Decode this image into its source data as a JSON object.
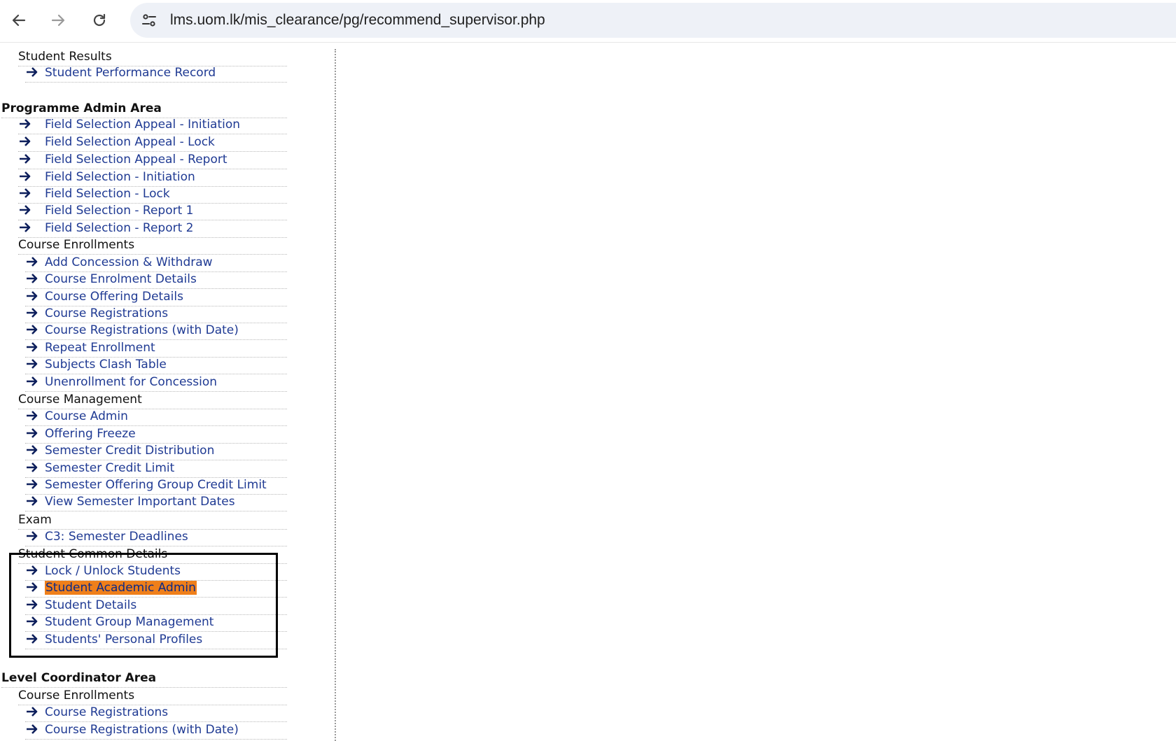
{
  "browser": {
    "url": "lms.uom.lk/mis_clearance/pg/recommend_supervisor.php",
    "icons": {
      "back": "arrow-left-icon",
      "forward": "arrow-right-icon",
      "reload": "reload-icon",
      "site_info": "tune-icon"
    }
  },
  "menu": {
    "student_results": {
      "label": "Student Results",
      "items": [
        "Student Performance Record"
      ]
    },
    "programme_admin": {
      "label": "Programme Admin Area",
      "items": [
        "Field Selection Appeal - Initiation",
        "Field Selection Appeal - Lock",
        "Field Selection Appeal - Report",
        "Field Selection - Initiation",
        "Field Selection - Lock",
        "Field Selection - Report 1",
        "Field Selection - Report 2"
      ],
      "course_enrollments": {
        "label": "Course Enrollments",
        "items": [
          "Add Concession & Withdraw",
          "Course Enrolment Details",
          "Course Offering Details",
          "Course Registrations",
          "Course Registrations (with Date)",
          "Repeat Enrollment",
          "Subjects Clash Table",
          "Unenrollment for Concession"
        ]
      },
      "course_management": {
        "label": "Course Management",
        "items": [
          "Course Admin",
          "Offering Freeze",
          "Semester Credit Distribution",
          "Semester Credit Limit",
          "Semester Offering Group Credit Limit",
          "View Semester Important Dates"
        ]
      },
      "exam": {
        "label": "Exam",
        "items": [
          "C3: Semester Deadlines"
        ]
      },
      "student_common": {
        "label": "Student Common Details",
        "items": [
          "Lock / Unlock Students",
          "Student Academic Admin",
          "Student Details",
          "Student Group Management",
          "Students' Personal Profiles"
        ],
        "selected": "Student Academic Admin"
      }
    },
    "level_coordinator": {
      "label": "Level Coordinator Area",
      "course_enrollments": {
        "label": "Course Enrollments",
        "items": [
          "Course Registrations",
          "Course Registrations (with Date)"
        ]
      }
    },
    "colors": {
      "link": "#1f3a93",
      "selected_bg": "#ef7f1a",
      "highlight_border": "#000000"
    }
  }
}
